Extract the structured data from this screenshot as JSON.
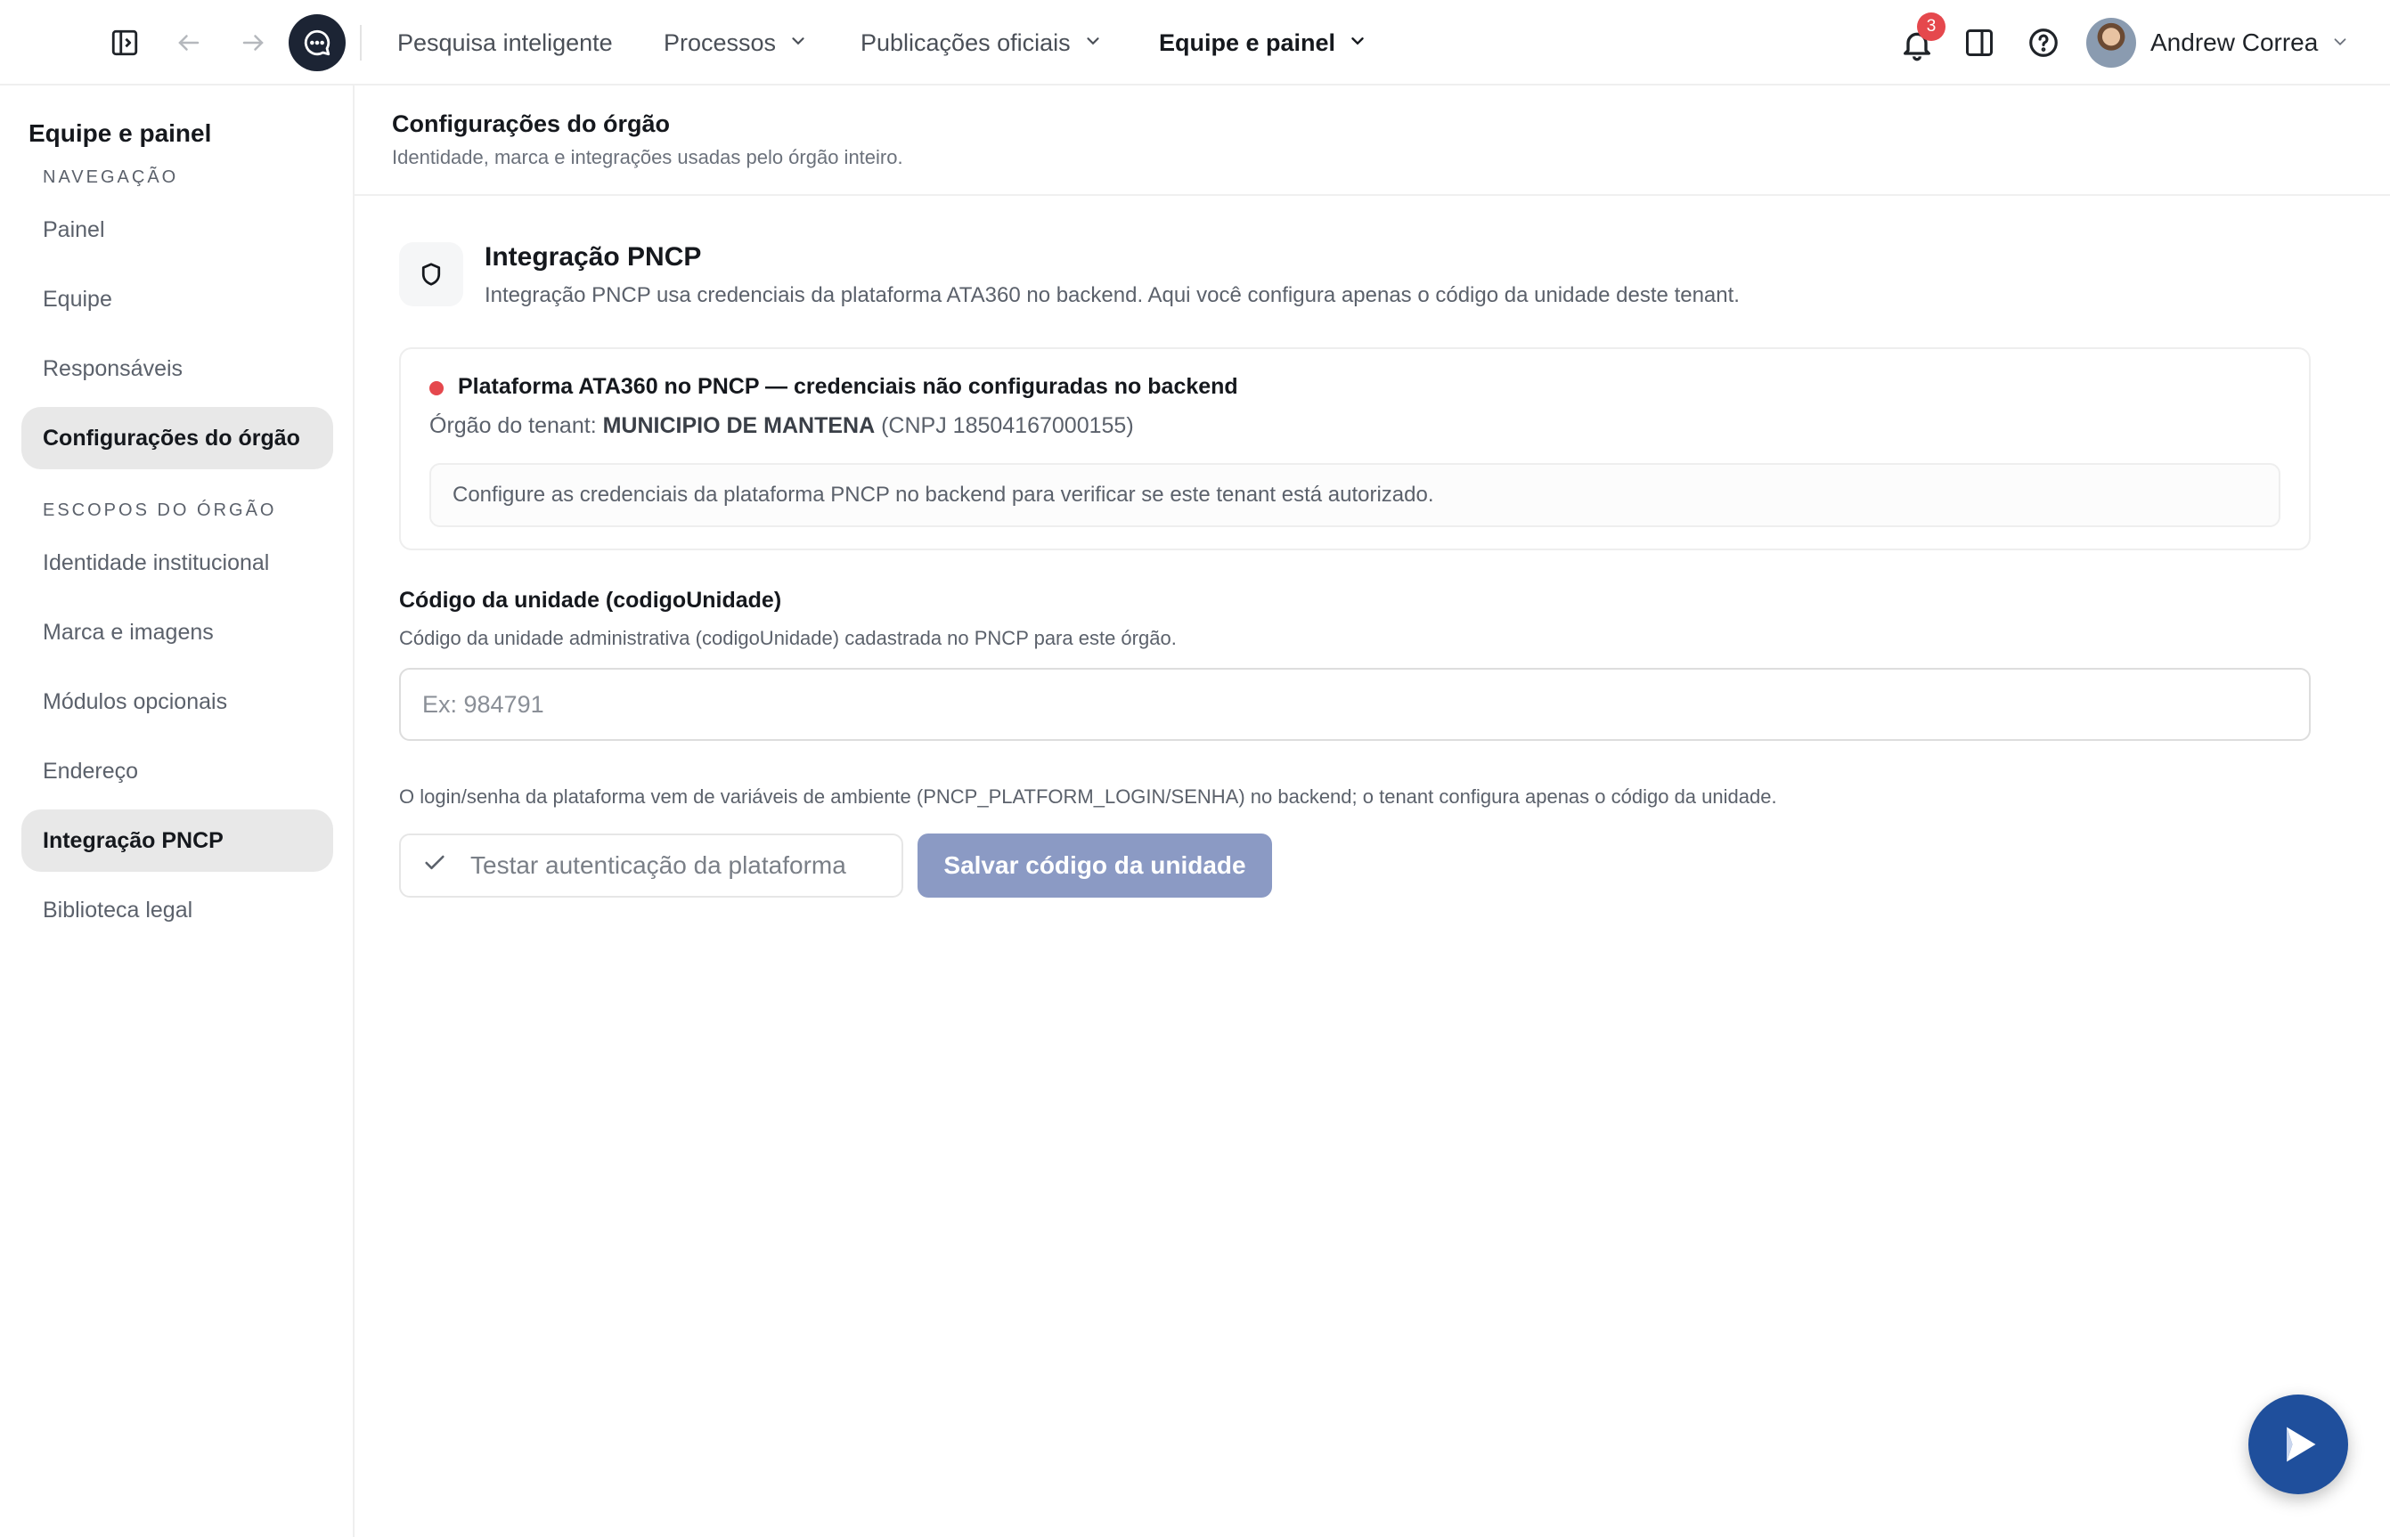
{
  "topbar": {
    "nav": [
      {
        "label": "Pesquisa inteligente",
        "has_chevron": false
      },
      {
        "label": "Processos",
        "has_chevron": true
      },
      {
        "label": "Publicações oficiais",
        "has_chevron": true
      },
      {
        "label": "Equipe e painel",
        "has_chevron": true,
        "active": true
      }
    ],
    "notifications_count": "3",
    "user_name": "Andrew Correa",
    "icons": [
      "sidebar-toggle-icon",
      "arrow-left-icon",
      "arrow-right-icon",
      "chat-icon",
      "bell-icon",
      "panel-icon",
      "help-icon",
      "chevron-down-icon"
    ]
  },
  "sidebar": {
    "title": "Equipe e painel",
    "sections": [
      {
        "heading": "NAVEGAÇÃO",
        "items": [
          {
            "label": "Painel"
          },
          {
            "label": "Equipe"
          },
          {
            "label": "Responsáveis"
          },
          {
            "label": "Configurações do órgão",
            "active": true
          }
        ]
      },
      {
        "heading": "ESCOPOS DO ÓRGÃO",
        "items": [
          {
            "label": "Identidade institucional"
          },
          {
            "label": "Marca e imagens"
          },
          {
            "label": "Módulos opcionais"
          },
          {
            "label": "Endereço"
          },
          {
            "label": "Integração PNCP",
            "active": true
          },
          {
            "label": "Biblioteca legal"
          }
        ]
      }
    ]
  },
  "page": {
    "title": "Configurações do órgão",
    "subtitle": "Identidade, marca e integrações usadas pelo órgão inteiro."
  },
  "integration": {
    "icon": "shield-icon",
    "title": "Integração PNCP",
    "description": "Integração PNCP usa credenciais da plataforma ATA360 no backend. Aqui você configura apenas o código da unidade deste tenant.",
    "status": {
      "color": "#e5484d",
      "title": "Plataforma ATA360 no PNCP — credenciais não configuradas no backend",
      "tenant_label": "Órgão do tenant:",
      "tenant_name": "MUNICIPIO DE MANTENA",
      "tenant_cnpj": "(CNPJ 18504167000155)",
      "note": "Configure as credenciais da plataforma PNCP no backend para verificar se este tenant está autorizado."
    },
    "field": {
      "label": "Código da unidade (codigoUnidade)",
      "help": "Código da unidade administrativa (codigoUnidade) cadastrada no PNCP para este órgão.",
      "value": "",
      "placeholder": "Ex: 984791"
    },
    "env_note": "O login/senha da plataforma vem de variáveis de ambiente (PNCP_PLATFORM_LOGIN/SENHA) no backend; o tenant configura apenas o código da unidade.",
    "test_button": "Testar autenticação da plataforma",
    "save_button": "Salvar código da unidade"
  },
  "colors": {
    "accent_dark": "#1c2434",
    "save_button": "#8b9ac4",
    "fab": "#1f4f9c",
    "badge": "#e5484d"
  }
}
